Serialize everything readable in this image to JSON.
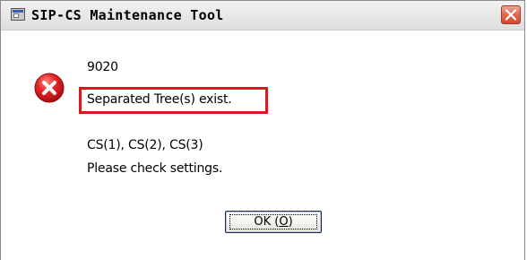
{
  "window": {
    "title": "SIP-CS Maintenance Tool",
    "close_icon": "close-icon",
    "app_icon": "app-window-icon"
  },
  "dialog": {
    "icon": "error-icon",
    "code": "9020",
    "message": "Separated Tree(s) exist.",
    "detail": "CS(1), CS(2), CS(3)",
    "instruction": "Please check settings.",
    "highlight_color": "#e0141c"
  },
  "buttons": {
    "ok_prefix": "OK (",
    "ok_mnemonic": "O",
    "ok_suffix": ")"
  }
}
